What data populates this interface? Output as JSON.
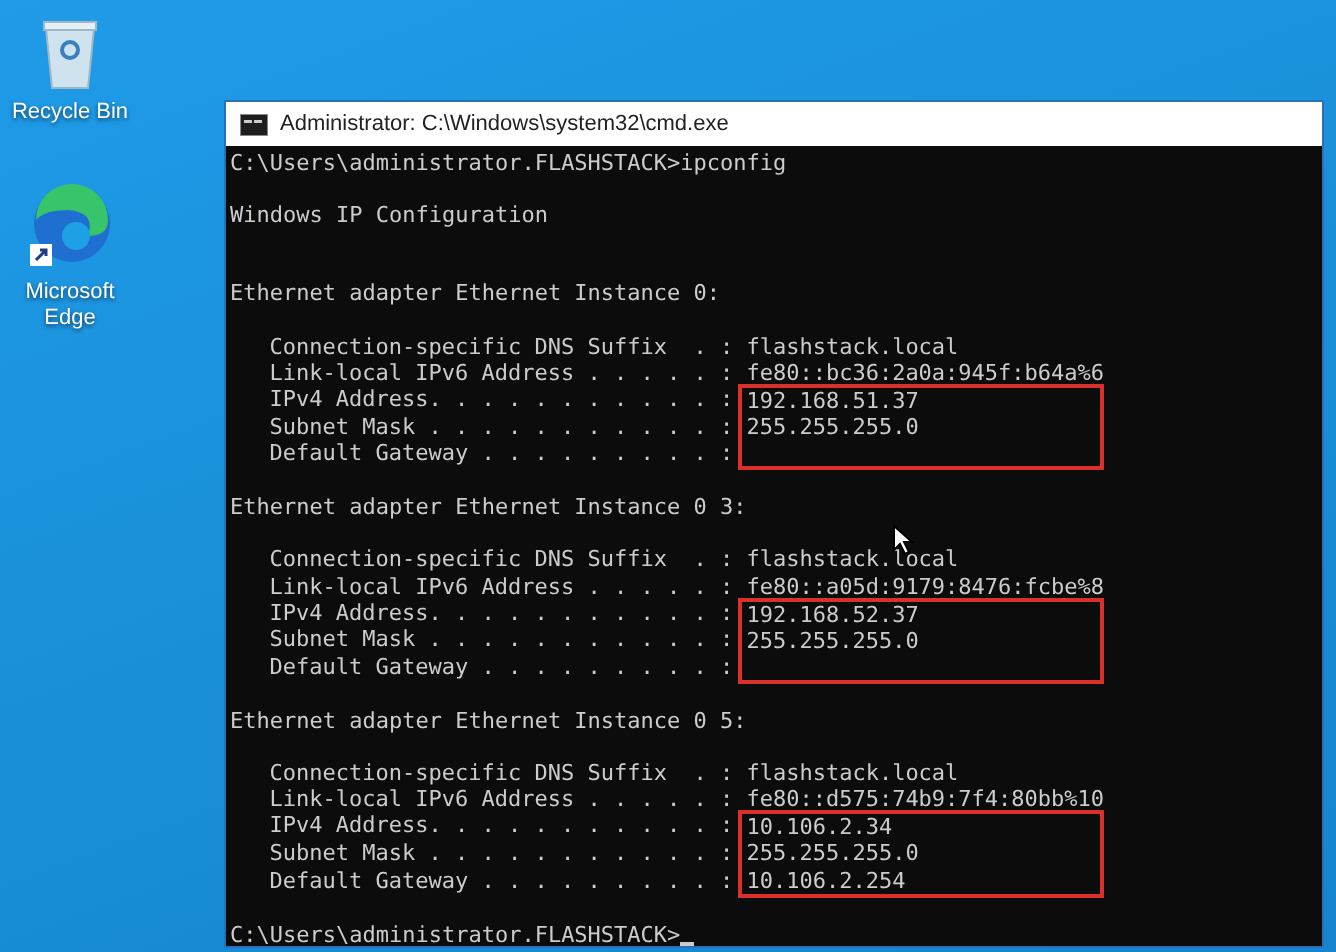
{
  "desktop_icons": [
    {
      "kind": "recycle-bin",
      "label": "Recycle Bin"
    },
    {
      "kind": "browser",
      "label": "Microsoft Edge"
    }
  ],
  "window": {
    "title": "Administrator: C:\\Windows\\system32\\cmd.exe"
  },
  "console": {
    "prompt_line": "C:\\Users\\administrator.FLASHSTACK>ipconfig",
    "heading": "Windows IP Configuration",
    "adapters": [
      {
        "header": "Ethernet adapter Ethernet Instance 0:",
        "properties": [
          {
            "label": "Connection-specific DNS Suffix  . : ",
            "value": "flashstack.local",
            "highlighted": false
          },
          {
            "label": "Link-local IPv6 Address . . . . . : ",
            "value": "fe80::bc36:2a0a:945f:b64a%6",
            "highlighted": false
          },
          {
            "label": "IPv4 Address. . . . . . . . . . . : ",
            "value": "192.168.51.37",
            "highlighted": true
          },
          {
            "label": "Subnet Mask . . . . . . . . . . . : ",
            "value": "255.255.255.0",
            "highlighted": true
          },
          {
            "label": "Default Gateway . . . . . . . . . : ",
            "highlighted": true
          }
        ]
      },
      {
        "header": "Ethernet adapter Ethernet Instance 0 3:",
        "properties": [
          {
            "label": "Connection-specific DNS Suffix  . : ",
            "value": "flashstack.local",
            "highlighted": false
          },
          {
            "label": "Link-local IPv6 Address . . . . . : ",
            "value": "fe80::a05d:9179:8476:fcbe%8",
            "highlighted": false
          },
          {
            "label": "IPv4 Address. . . . . . . . . . . : ",
            "value": "192.168.52.37",
            "highlighted": true
          },
          {
            "label": "Subnet Mask . . . . . . . . . . . : ",
            "value": "255.255.255.0",
            "highlighted": true
          },
          {
            "label": "Default Gateway . . . . . . . . . : ",
            "highlighted": true
          }
        ]
      },
      {
        "header": "Ethernet adapter Ethernet Instance 0 5:",
        "properties": [
          {
            "label": "Connection-specific DNS Suffix  . : ",
            "value": "flashstack.local",
            "highlighted": false
          },
          {
            "label": "Link-local IPv6 Address . . . . . : ",
            "value": "fe80::d575:74b9:7f4:80bb%10",
            "highlighted": false
          },
          {
            "label": "IPv4 Address. . . . . . . . . . . : ",
            "value": "10.106.2.34",
            "highlighted": true
          },
          {
            "label": "Subnet Mask . . . . . . . . . . . : ",
            "value": "255.255.255.0",
            "highlighted": true
          },
          {
            "label": "Default Gateway . . . . . . . . . : ",
            "value": "10.106.2.254",
            "highlighted": true
          }
        ]
      }
    ],
    "final_prompt": "C:\\Users\\administrator.FLASHSTACK>"
  }
}
